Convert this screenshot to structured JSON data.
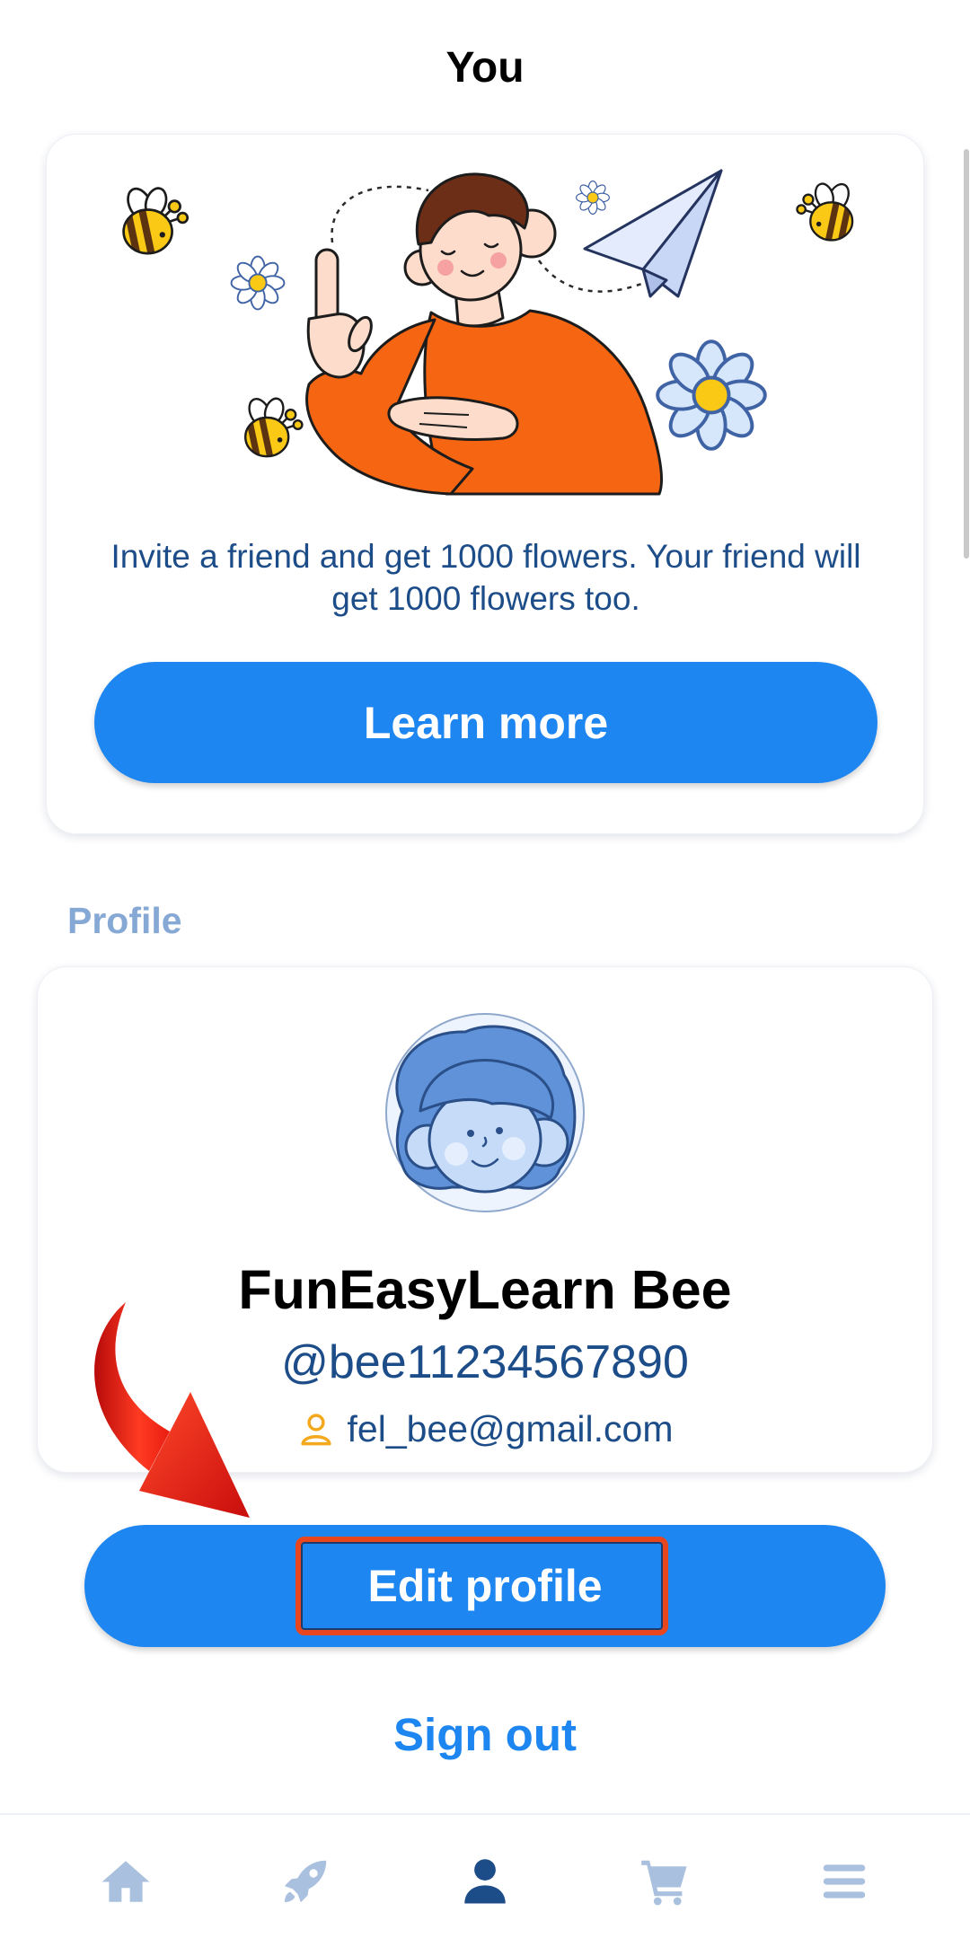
{
  "screen": {
    "title": "You"
  },
  "invite": {
    "message": "Invite a friend and get 1000 flowers. Your friend will get 1000 flowers too.",
    "button_label": "Learn more"
  },
  "profile": {
    "section_label": "Profile",
    "name": "FunEasyLearn Bee",
    "username": "@bee11234567890",
    "email": "fel_bee@gmail.com",
    "email_icon": "person-outline-icon",
    "edit_button_label": "Edit profile"
  },
  "account": {
    "sign_out_label": "Sign out"
  },
  "bottom_nav": {
    "items": [
      {
        "icon": "home-icon",
        "active": false
      },
      {
        "icon": "rocket-icon",
        "active": false
      },
      {
        "icon": "profile-icon",
        "active": true
      },
      {
        "icon": "cart-icon",
        "active": false
      },
      {
        "icon": "menu-icon",
        "active": false
      }
    ]
  },
  "annotation": {
    "arrow_icon": "curved-arrow-icon"
  },
  "colors": {
    "primary": "#1e86f0",
    "text_blue": "#1d4d88",
    "section_label": "#86a8d4",
    "nav_inactive": "#a9c0de",
    "nav_active": "#1d4d88",
    "email_icon": "#f4a81d",
    "annotation_red": "#e8461f"
  }
}
